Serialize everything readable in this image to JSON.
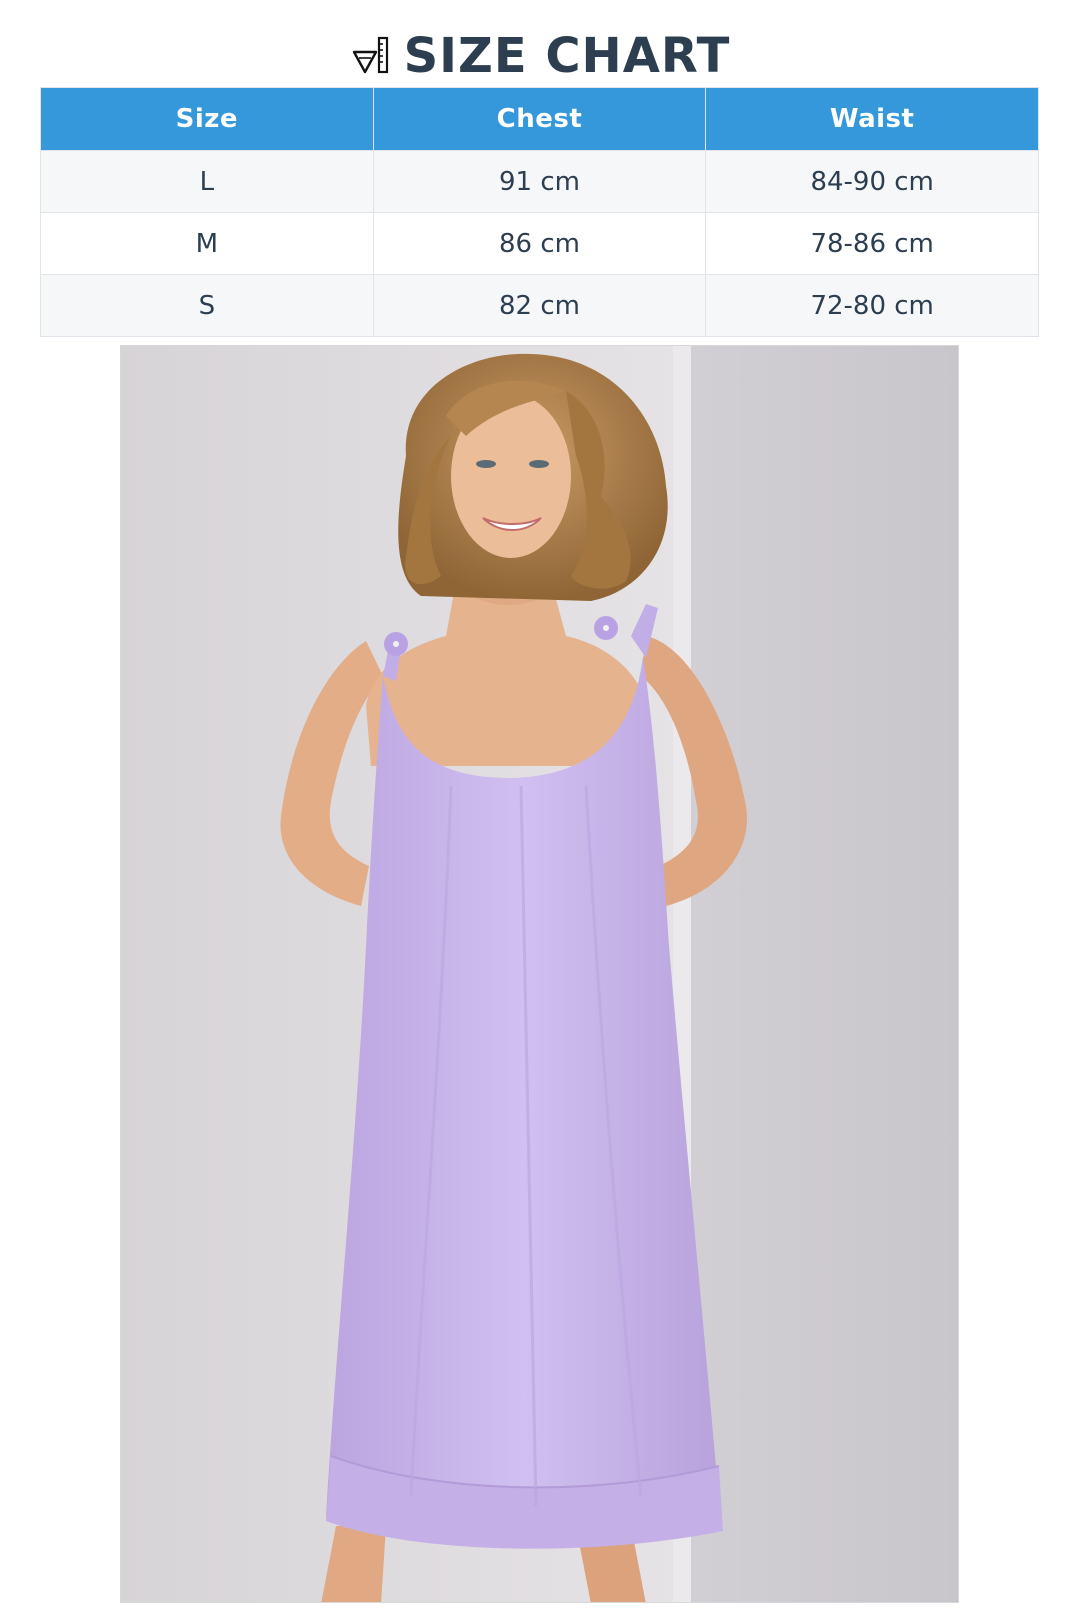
{
  "header": {
    "title": "SIZE CHART",
    "icon": "ruler-triangle-icon"
  },
  "table": {
    "columns": [
      "Size",
      "Chest",
      "Waist"
    ],
    "rows": [
      {
        "size": "L",
        "chest": "91 cm",
        "waist": "84-90 cm"
      },
      {
        "size": "M",
        "chest": "86 cm",
        "waist": "78-86 cm"
      },
      {
        "size": "S",
        "chest": "82 cm",
        "waist": "72-80 cm"
      }
    ]
  },
  "colors": {
    "header_bg": "#3498db",
    "title_text": "#2c3e50",
    "dress": "#c9b6ea"
  },
  "photo": {
    "subject": "product-photo"
  }
}
